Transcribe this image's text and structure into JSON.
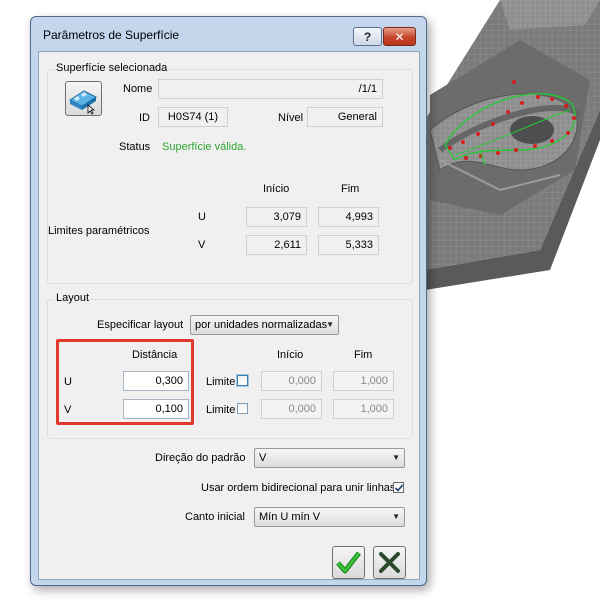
{
  "dialog": {
    "title": "Parâmetros de Superfície",
    "help_label": "?",
    "close_label": "✕"
  },
  "surface": {
    "group_title": "Superfície selecionada",
    "name_label": "Nome",
    "name_value": "/1/1",
    "id_label": "ID",
    "id_value": "H0S74 (1)",
    "level_label": "Nível",
    "level_value": "General",
    "status_label": "Status",
    "status_value": "Superfície válida.",
    "status_color": "#2ea832",
    "icon": "surface-select-icon"
  },
  "limits": {
    "start_header": "Início",
    "end_header": "Fim",
    "label": "Limites paramétricos",
    "u_label": "U",
    "v_label": "V",
    "u_start": "3,079",
    "u_end": "4,993",
    "v_start": "2,611",
    "v_end": "5,333"
  },
  "layout": {
    "group_title": "Layout",
    "specify_label": "Especificar layout",
    "specify_value": "por unidades normalizadas",
    "distance_header": "Distância",
    "start_header": "Início",
    "end_header": "Fim",
    "u_label": "U",
    "v_label": "V",
    "u_distance": "0,300",
    "v_distance": "0,100",
    "limit_label": "Limite",
    "u_limit_checked": false,
    "v_limit_checked": false,
    "u_start": "0,000",
    "u_end": "1,000",
    "v_start": "0,000",
    "v_end": "1,000"
  },
  "options": {
    "pattern_direction_label": "Direção do padrão",
    "pattern_direction_value": "V",
    "bidirectional_label": "Usar ordem bidirecional para unir linhas",
    "bidirectional_checked": true,
    "start_corner_label": "Canto inicial",
    "start_corner_value": "Mín U mín V"
  },
  "buttons": {
    "ok_icon": "green-check-icon",
    "cancel_icon": "x-cancel-icon"
  },
  "colors": {
    "highlight": "#e03a2f",
    "accent_green": "#2ea832",
    "titlebar": "#c3d6ec"
  }
}
